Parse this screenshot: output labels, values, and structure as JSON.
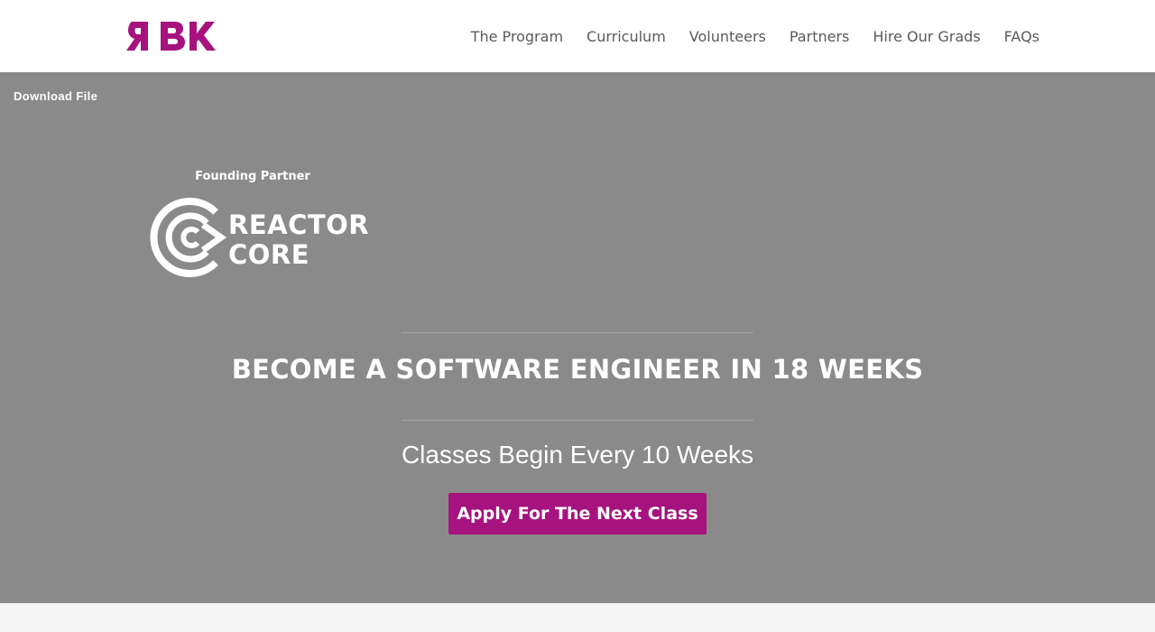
{
  "brand": {
    "logo_text": "ЯBK",
    "color": "#a6137e"
  },
  "nav": {
    "items": [
      {
        "label": "The Program"
      },
      {
        "label": "Curriculum"
      },
      {
        "label": "Volunteers"
      },
      {
        "label": "Partners"
      },
      {
        "label": "Hire Our Grads"
      },
      {
        "label": "FAQs"
      }
    ]
  },
  "hero": {
    "download_label": "Download File",
    "founding_label": "Founding Partner",
    "partner": {
      "line1": "REACTOR",
      "line2": "CORE"
    },
    "headline": "BECOME A SOFTWARE ENGINEER IN 18 WEEKS",
    "subline": "Classes Begin Every 10 Weeks",
    "cta_label": "Apply For The Next Class",
    "background_color": "#8a8a8a"
  }
}
